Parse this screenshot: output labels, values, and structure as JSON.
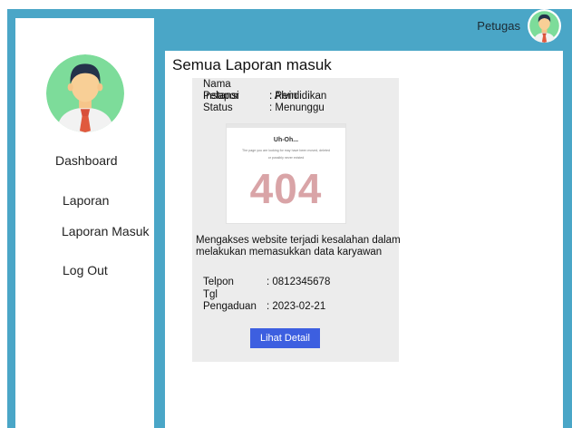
{
  "topbar": {
    "user_label": "Petugas"
  },
  "sidebar": {
    "items": [
      {
        "label": "Dashboard"
      },
      {
        "label": "Laporan"
      },
      {
        "label": "Laporan Masuk"
      },
      {
        "label": "Log Out"
      }
    ]
  },
  "main": {
    "title": "Semua Laporan masuk",
    "report": {
      "nama_label": "Nama Pelapor",
      "nama_value": ": Alvin",
      "instansi_label": "Instansi",
      "instansi_value": ": Pendidikan",
      "status_label": "Status",
      "status_value": ": Menunggu",
      "image": {
        "heading": "Uh-Oh...",
        "line1": "The page you are looking for may have been moved, deleted",
        "line2": "or possibly never existed",
        "code": "404"
      },
      "description": "Mengakses website terjadi kesalahan dalam melakukan memasukkan data karyawan",
      "telpon_label": "Telpon",
      "telpon_value": ": 0812345678",
      "tgl_label": "Tgl Pengaduan",
      "tgl_value": ": 2023-02-21",
      "detail_button": "Lihat Detail"
    }
  },
  "colors": {
    "frame": "#4aa6c7",
    "button": "#3d5fe0",
    "card": "#ececec",
    "avatar_bg": "#7ddc9a"
  },
  "icons": {
    "user_avatar": "person-avatar-icon"
  }
}
